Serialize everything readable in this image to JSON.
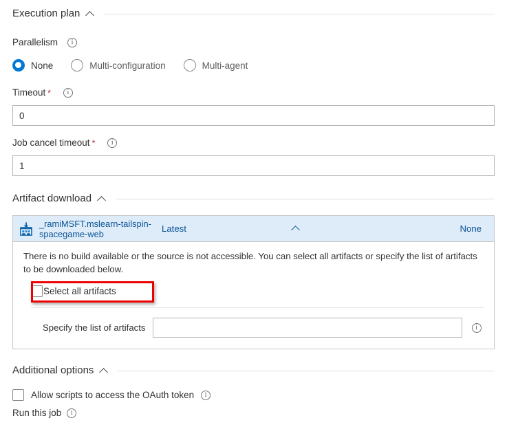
{
  "sections": {
    "execution_plan": {
      "title": "Execution plan",
      "collapse_icon": "chevron-up-icon",
      "parallelism": {
        "label": "Parallelism",
        "info_icon": "info-icon",
        "options": [
          {
            "label": "None",
            "selected": true
          },
          {
            "label": "Multi-configuration",
            "selected": false
          },
          {
            "label": "Multi-agent",
            "selected": false
          }
        ]
      },
      "timeout": {
        "label": "Timeout",
        "required": "*",
        "info_icon": "info-icon",
        "value": "0"
      },
      "job_cancel_timeout": {
        "label": "Job cancel timeout",
        "required": "*",
        "info_icon": "info-icon",
        "value": "1"
      }
    },
    "artifact_download": {
      "title": "Artifact download",
      "collapse_icon": "chevron-up-icon",
      "artifact": {
        "icon": "artifact-download-icon",
        "name": "_ramiMSFT.mslearn-tailspin-spacegame-web",
        "version": "Latest",
        "expand_icon": "chevron-up-icon",
        "download_type": "None"
      },
      "message": "There is no build available or the source is not accessible. You can select all artifacts or specify the list of artifacts to be downloaded below.",
      "select_all": {
        "label": "Select all artifacts",
        "checked": false,
        "highlighted": true,
        "highlight_color": "#ee0000"
      },
      "specify": {
        "label": "Specify the list of artifacts",
        "value": "",
        "placeholder": "",
        "info_icon": "info-icon"
      }
    },
    "additional_options": {
      "title": "Additional options",
      "collapse_icon": "chevron-up-icon",
      "oauth": {
        "label": "Allow scripts to access the OAuth token",
        "checked": false,
        "info_icon": "info-icon"
      },
      "run_this_job": {
        "label": "Run this job",
        "info_icon": "info-icon"
      }
    }
  },
  "colors": {
    "accent": "#0078d4",
    "link": "#0b5394",
    "header_bg": "#deecf9",
    "highlight": "#ee0000",
    "required": "#a4262c"
  }
}
